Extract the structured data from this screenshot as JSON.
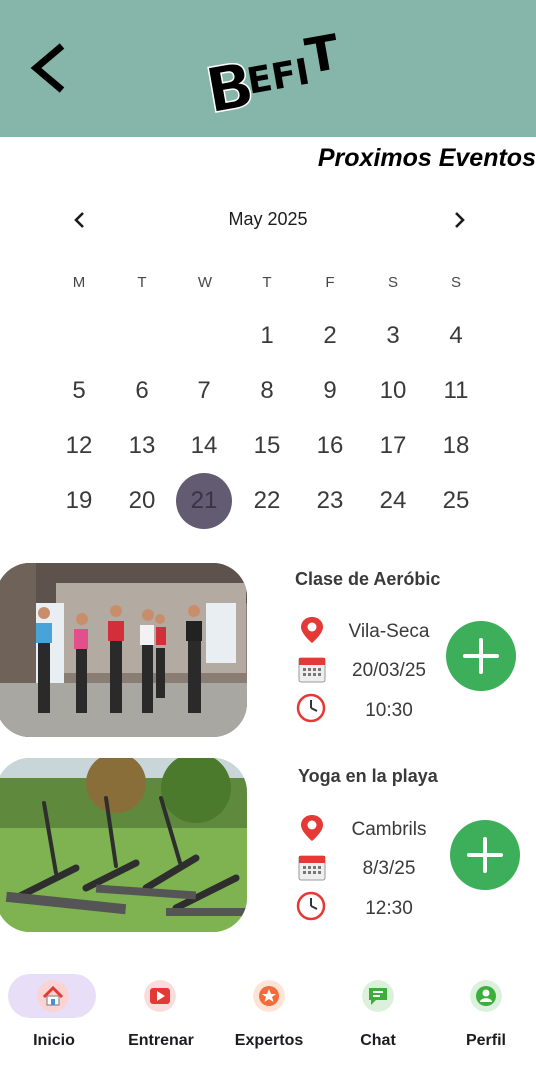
{
  "header": {
    "back_icon": "chevron-left-icon",
    "logo_text": "BEFIT"
  },
  "section_title": "Proximos Eventos",
  "calendar": {
    "month_label": "May 2025",
    "weekdays": [
      "M",
      "T",
      "W",
      "T",
      "F",
      "S",
      "S"
    ],
    "weeks": [
      [
        "",
        "",
        "",
        "1",
        "2",
        "3",
        "4"
      ],
      [
        "5",
        "6",
        "7",
        "8",
        "9",
        "10",
        "11"
      ],
      [
        "12",
        "13",
        "14",
        "15",
        "16",
        "17",
        "18"
      ],
      [
        "19",
        "20",
        "21",
        "22",
        "23",
        "24",
        "25"
      ]
    ],
    "selected_day": "21",
    "selected_color": "#625b71"
  },
  "events": [
    {
      "title": "Clase de Aeróbic",
      "location": "Vila-Seca",
      "date": "20/03/25",
      "time": "10:30",
      "image": "aerobic-class-photo"
    },
    {
      "title": "Yoga en la playa",
      "location": "Cambrils",
      "date": "8/3/25",
      "time": "12:30",
      "image": "yoga-park-photo"
    }
  ],
  "nav": [
    {
      "label": "Inicio",
      "icon": "home-icon",
      "active": true
    },
    {
      "label": "Entrenar",
      "icon": "play-icon"
    },
    {
      "label": "Expertos",
      "icon": "star-icon"
    },
    {
      "label": "Chat",
      "icon": "chat-icon"
    },
    {
      "label": "Perfil",
      "icon": "profile-icon"
    }
  ],
  "colors": {
    "header": "#86b5a9",
    "accent_green": "#3dae5a",
    "nav_active": "#e8def8"
  }
}
